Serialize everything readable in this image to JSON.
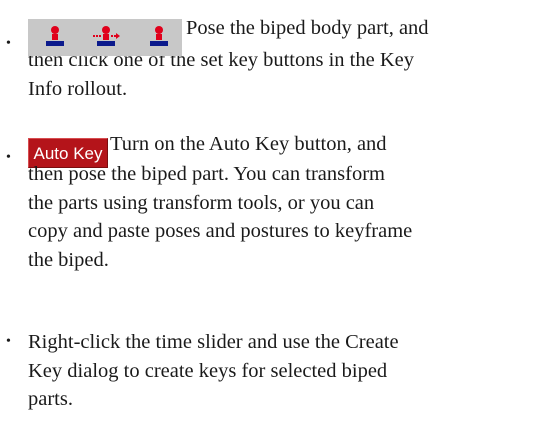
{
  "bullets": [
    {
      "marker": "•",
      "icons": [
        "set-key-icon",
        "set-sliding-key-icon",
        "set-free-key-icon"
      ],
      "lines": [
        "Pose the biped body part, and",
        "then click one of the set key buttons in the Key",
        "Info rollout."
      ]
    },
    {
      "marker": "•",
      "button_label": "Auto Key",
      "lines": [
        "Turn on the Auto Key button, and",
        "then pose the biped part.  You can transform",
        "the parts using transform tools, or you can",
        "copy and paste poses and postures to keyframe",
        "the biped."
      ]
    },
    {
      "marker": "•",
      "lines": [
        "Right-click the time slider and use the Create",
        "Key dialog to create keys for selected biped",
        "parts."
      ]
    }
  ],
  "colors": {
    "icon_red": "#e0001b",
    "icon_blue": "#0b1a8c",
    "auto_key_bg": "#b4141a",
    "icon_bar_bg": "#c8c8c8"
  }
}
